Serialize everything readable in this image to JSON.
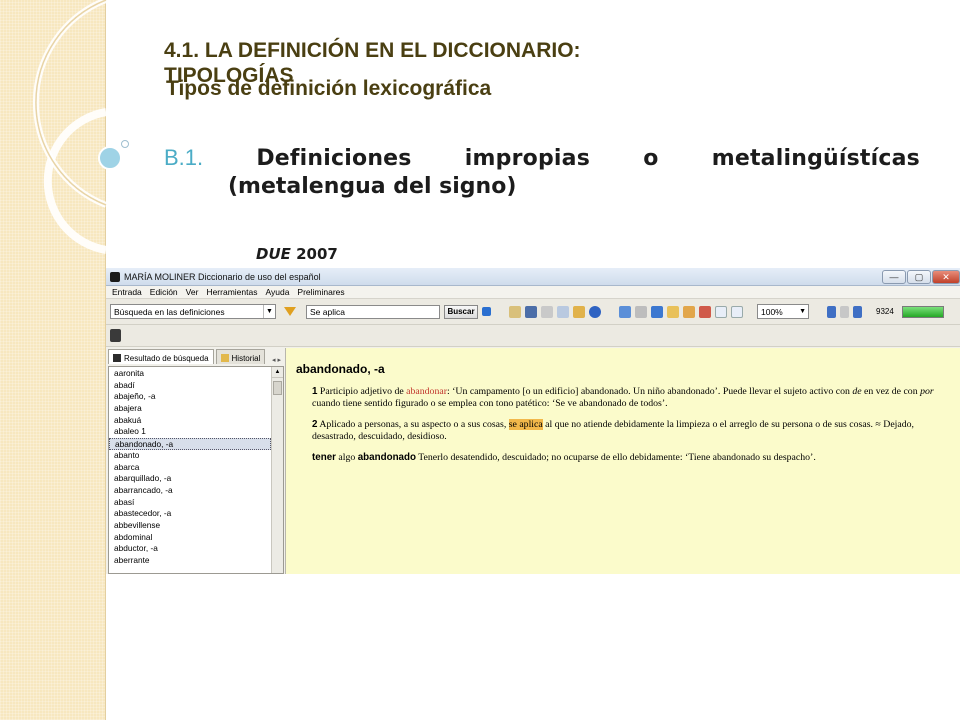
{
  "slide": {
    "title": "4.1. LA DEFINICIÓN EN EL DICCIONARIO: TIPOLOGÍAS",
    "subtitle": "Tipos de definición lexicográfica",
    "b1_label": "B.1.",
    "b1_words": [
      "Definiciones",
      "impropias",
      "o",
      "metalingüístícas"
    ],
    "b1_line2": "(metalengua del signo)",
    "due_italic": "DUE",
    "due_year": "2007",
    "colors": {
      "title": "#4a3f12",
      "accent": "#4bacc6",
      "strip": "#f7e7bf"
    }
  },
  "app": {
    "window_title": "MARÍA MOLINER   Diccionario de uso del español",
    "window_controls": {
      "minimize": "—",
      "maximize": "▢",
      "close": "✕"
    },
    "menu": [
      "Entrada",
      "Edición",
      "Ver",
      "Herramientas",
      "Ayuda",
      "Preliminares"
    ],
    "toolbar": {
      "search_mode": "Búsqueda en las definiciones",
      "search_value": "Se aplica",
      "search_button": "Buscar",
      "zoom": "100%",
      "count": "9324",
      "progress": 1.0
    },
    "left_pane": {
      "tabs": [
        "Resultado de búsqueda",
        "Historial"
      ],
      "tab_nav": "◂ ▸",
      "results": [
        "aaronita",
        "abadí",
        "abajeño, -a",
        "abajera",
        "abakuá",
        "abaleo 1",
        "abandonado, -a",
        "abanto",
        "abarca",
        "abarquillado, -a",
        "abarrancado, -a",
        "abasí",
        "abastecedor, -a",
        "abbevillense",
        "abdominal",
        "abductor, -a",
        "aberrante"
      ],
      "selected_index": 6
    },
    "definition": {
      "headword": "abandonado, -a",
      "sense1": {
        "num": "1",
        "t1": " Participio adjetivo de ",
        "xref": "abandonar",
        "t2": ": ‘Un campamento [o un edificio] abandonado. Un niño abandonado’. Puede llevar el sujeto activo con ",
        "de": "de",
        "t3": " en vez de con ",
        "por": "por",
        "t4": " cuando tiene sentido figurado o se emplea con tono patético: ‘Se ve abandonado de todos’."
      },
      "sense2": {
        "num": "2",
        "t1": " Aplicado a personas, a su aspecto o a sus cosas, ",
        "hl": "se aplica",
        "t2": " al que no atiende debidamente la limpieza o el arreglo de su persona o de sus cosas. ≈ Dejado, desastrado, descuidado, desidioso."
      },
      "phrase": {
        "kw1": "tener",
        "mid": " algo ",
        "kw2": "abandonado",
        "t": " Tenerlo desatendido, descuidado; no ocuparse de ello debidamente: ‘Tiene abandonado su despacho’."
      }
    }
  }
}
